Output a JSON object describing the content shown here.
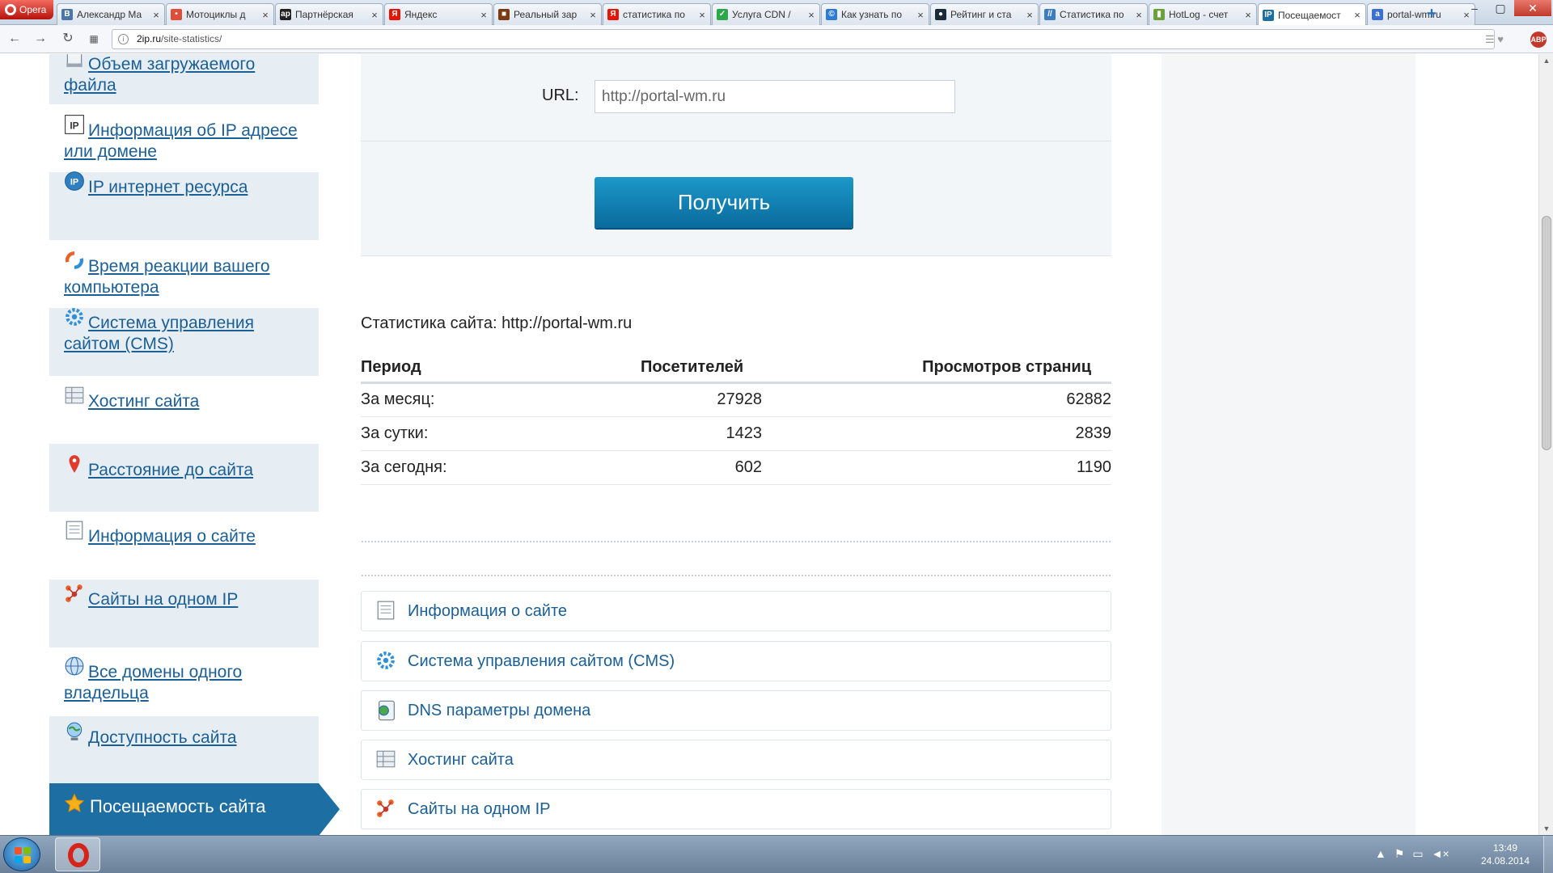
{
  "browser": {
    "menu_label": "Opera",
    "tabs": [
      {
        "title": "Александр Ма",
        "fav_color": "#4a76a8",
        "fav_text": "В"
      },
      {
        "title": "Мотоциклы д",
        "fav_color": "#e04e39",
        "fav_text": "•"
      },
      {
        "title": "Партнёрская",
        "fav_color": "#222222",
        "fav_text": "ap"
      },
      {
        "title": "Яндекс",
        "fav_color": "#e61400",
        "fav_text": "Я"
      },
      {
        "title": "Реальный зар",
        "fav_color": "#7a3a12",
        "fav_text": "■"
      },
      {
        "title": "статистика по",
        "fav_color": "#e61400",
        "fav_text": "Я"
      },
      {
        "title": "Услуга CDN /",
        "fav_color": "#2aa84a",
        "fav_text": "✓"
      },
      {
        "title": "Как узнать по",
        "fav_color": "#2b7bd6",
        "fav_text": "©"
      },
      {
        "title": "Рейтинг и ста",
        "fav_color": "#1b2a3a",
        "fav_text": "●"
      },
      {
        "title": "Статистика по",
        "fav_color": "#3d7dbf",
        "fav_text": "//"
      },
      {
        "title": "HotLog - счет",
        "fav_color": "#6ba03a",
        "fav_text": "▮"
      },
      {
        "title": "Посещаемост",
        "fav_color": "#1d6ea3",
        "fav_text": "IP",
        "active": true
      },
      {
        "title": "portal-wm.ru",
        "fav_color": "#3b6fd0",
        "fav_text": "a"
      }
    ],
    "url_host": "2ip.ru",
    "url_path": "/site-statistics/"
  },
  "sidebar": {
    "items": [
      {
        "label": "Объем загружаемого файла",
        "icon": "file-size-icon"
      },
      {
        "label": "Информация об IP адресе или домене",
        "icon": "ip-info-icon"
      },
      {
        "label": "IP интернет ресурса",
        "icon": "ip-resource-icon"
      },
      {
        "label": "Время реакции вашего компьютера",
        "icon": "reaction-time-icon"
      },
      {
        "label": "Система управления сайтом (CMS)",
        "icon": "cms-gear-icon"
      },
      {
        "label": "Хостинг сайта",
        "icon": "hosting-icon"
      },
      {
        "label": "Расстояние до сайта",
        "icon": "map-pin-icon"
      },
      {
        "label": "Информация о сайте",
        "icon": "document-icon"
      },
      {
        "label": "Сайты на одном IP",
        "icon": "network-icon"
      },
      {
        "label": "Все домены одного владельца",
        "icon": "globe-owner-icon"
      },
      {
        "label": "Доступность сайта",
        "icon": "availability-globe-icon"
      }
    ],
    "active_label": "Посещаемость сайта",
    "active_icon": "star-icon"
  },
  "form": {
    "url_label": "URL:",
    "url_value": "http://portal-wm.ru",
    "submit_label": "Получить"
  },
  "stats": {
    "title": "Статистика сайта: http://portal-wm.ru",
    "headers": {
      "period": "Период",
      "visitors": "Посетителей",
      "pageviews": "Просмотров страниц"
    },
    "rows": [
      {
        "period": "За месяц:",
        "visitors": "27928",
        "pageviews": "62882"
      },
      {
        "period": "За сутки:",
        "visitors": "1423",
        "pageviews": "2839"
      },
      {
        "period": "За сегодня:",
        "visitors": "602",
        "pageviews": "1190"
      }
    ]
  },
  "related_links": [
    {
      "label": "Информация о сайте",
      "icon": "document-icon"
    },
    {
      "label": "Система управления сайтом (CMS)",
      "icon": "cms-gear-icon"
    },
    {
      "label": "DNS параметры домена",
      "icon": "dns-icon"
    },
    {
      "label": "Хостинг сайта",
      "icon": "hosting-icon"
    },
    {
      "label": "Сайты на одном IP",
      "icon": "network-icon"
    }
  ],
  "taskbar": {
    "time": "13:49",
    "date": "24.08.2014"
  },
  "colors": {
    "link": "#1b5f95",
    "sidebar_active": "#1d6ea3",
    "button": "#0a6a9c"
  }
}
